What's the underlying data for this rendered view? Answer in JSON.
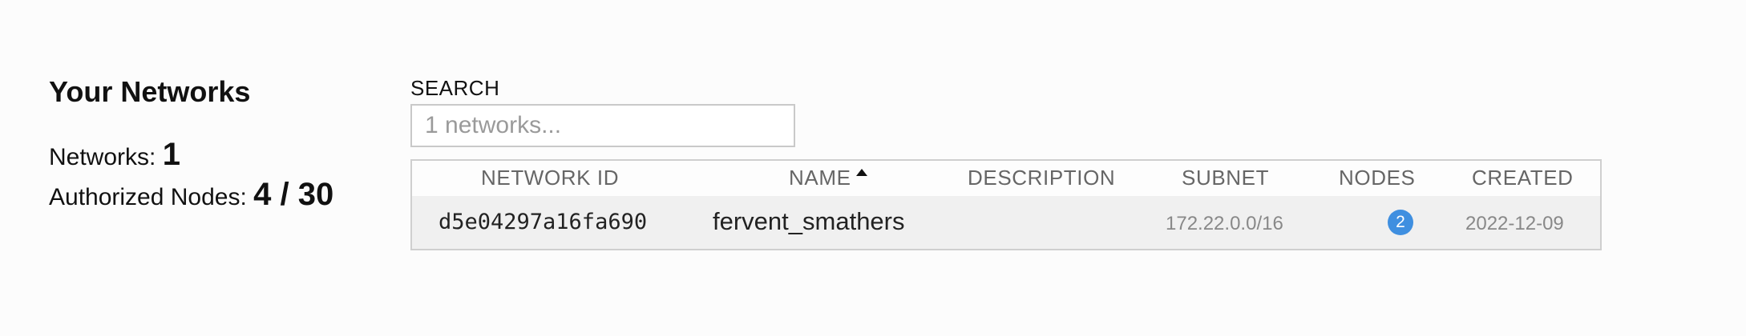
{
  "summary": {
    "title": "Your Networks",
    "networks_label": "Networks:",
    "networks_count": "1",
    "nodes_label": "Authorized Nodes:",
    "nodes_value": "4 / 30"
  },
  "search": {
    "label": "SEARCH",
    "placeholder": "1 networks...",
    "value": ""
  },
  "table": {
    "columns": {
      "network_id": "NETWORK ID",
      "name": "NAME",
      "description": "DESCRIPTION",
      "subnet": "SUBNET",
      "nodes": "NODES",
      "created": "CREATED"
    },
    "sorted_by": "name",
    "sort_direction": "ascending",
    "rows": [
      {
        "network_id": "d5e04297a16fa690",
        "name": "fervent_smathers",
        "description": "",
        "subnet": "172.22.0.0/16",
        "nodes": "2",
        "created": "2022-12-09"
      }
    ]
  },
  "colors": {
    "badge": "#3f8fe0",
    "row_bg": "#f0f0f0",
    "header_text": "#666666"
  }
}
